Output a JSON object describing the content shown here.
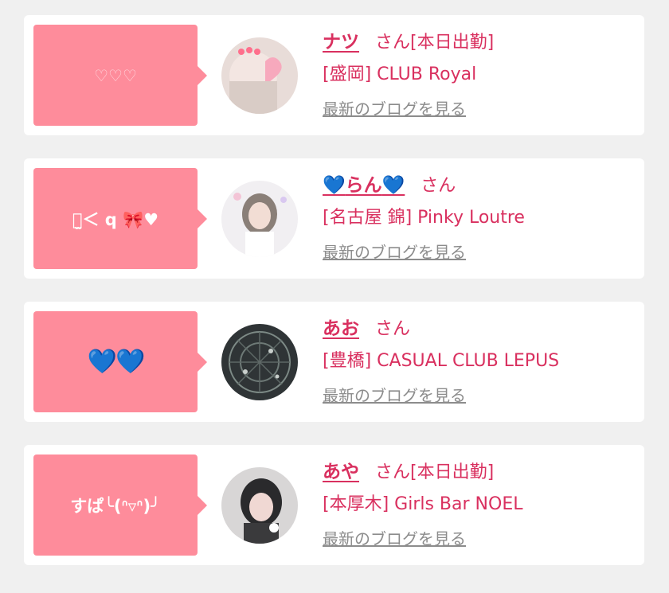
{
  "cards": [
    {
      "message": "♡♡♡",
      "name": "ナツ",
      "honorific": "さん",
      "badge": "[本日出勤]",
      "shop": "[盛岡] CLUB Royal",
      "blog_link": "最新のブログを見る",
      "avatar_icon": "girl-photo-avatar"
    },
    {
      "message": "＞̫＜ q 🎀♥",
      "name_heart_left": "💙",
      "name": "らん",
      "name_heart_right": "💙",
      "honorific": "さん",
      "badge": "",
      "shop": "[名古屋 錦] Pinky Loutre",
      "blog_link": "最新のブログを見る",
      "avatar_icon": "girl-photo-avatar"
    },
    {
      "message": "💙💙",
      "name": "あお",
      "honorific": "さん",
      "badge": "",
      "shop": "[豊橋] CASUAL CLUB LEPUS",
      "blog_link": "最新のブログを見る",
      "avatar_icon": "dark-pattern-avatar"
    },
    {
      "message": "すぱ╰(ᐢ▿ᐢ)╯",
      "name": "あや",
      "honorific": "さん",
      "badge": "[本日出勤]",
      "shop": "[本厚木] Girls Bar NOEL",
      "blog_link": "最新のブログを見る",
      "avatar_icon": "girl-photo-avatar"
    }
  ],
  "colors": {
    "accent": "#d9305f",
    "bubble": "#fe8c9b",
    "link_gray": "#8c8c8c",
    "page_bg": "#f0f0f0"
  }
}
